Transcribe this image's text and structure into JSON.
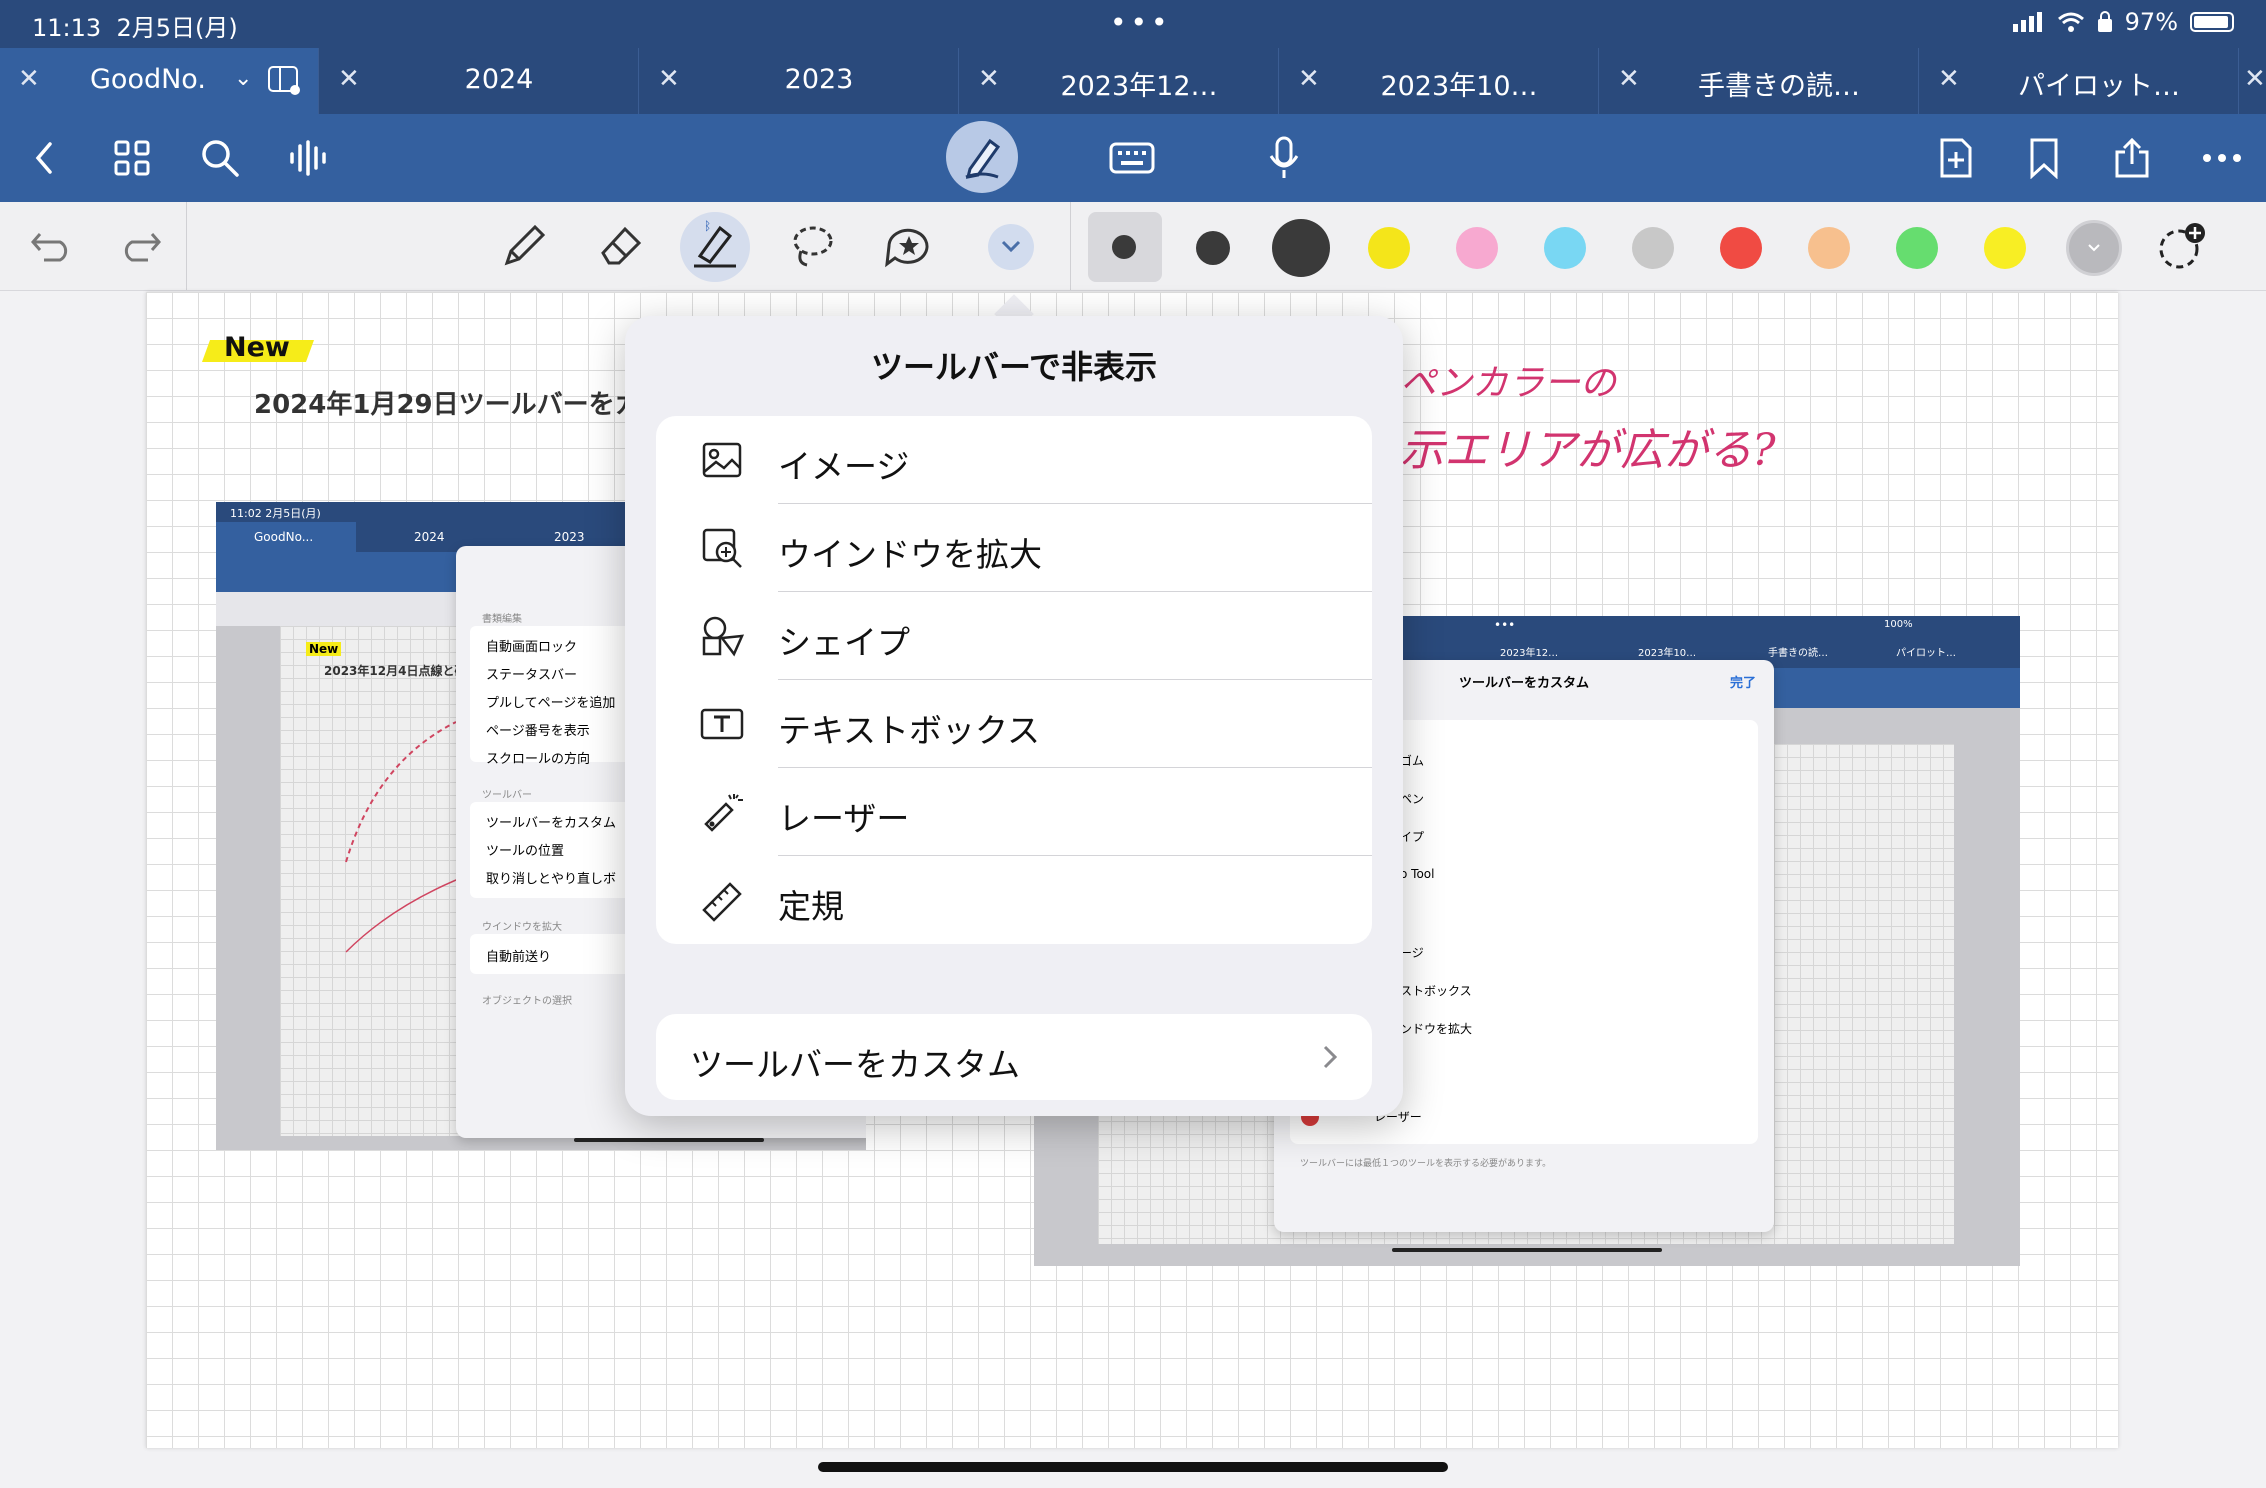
{
  "status": {
    "time": "11:13",
    "date": "2月5日(月)",
    "battery": "97%"
  },
  "tabs": [
    {
      "label": "GoodNo...",
      "active": true
    },
    {
      "label": "2024"
    },
    {
      "label": "2023"
    },
    {
      "label": "2023年12…"
    },
    {
      "label": "2023年10…"
    },
    {
      "label": "手書きの読…"
    },
    {
      "label": "パイロット…"
    }
  ],
  "toolbar_colors": [
    "#3a3a3a",
    "#3a3a3a",
    "#3a3a3a",
    "#f4e51a",
    "#f7a9d0",
    "#79d7f3",
    "#c8c8c8",
    "#f04b43",
    "#f7c08e",
    "#66dd6f",
    "#f8ee24",
    "#b9b9bd"
  ],
  "canvas": {
    "new_badge": "New",
    "heading": "2024年1月29日ツールバーをカ",
    "handwriting_line1": "ペンカラーの",
    "handwriting_line2": "示エリアが広がる?",
    "left_shot": {
      "time": "11:02  2月5日(月)",
      "tabs": [
        "GoodNo...",
        "2024",
        "2023"
      ],
      "new": "New",
      "heading": "2023年12月4日点線と破",
      "menu_section1": "書類編集",
      "menu_items1": [
        "自動画面ロック",
        "ステータスバー",
        "プルしてページを追加",
        "ページ番号を表示",
        "スクロールの方向"
      ],
      "menu_section2": "ツールバー",
      "menu_items2": [
        "ツールバーをカスタム",
        "ツールの位置",
        "取り消しとやり直しボ"
      ],
      "menu_section3": "ウインドウを拡大",
      "menu_items3": [
        "自動前送り"
      ],
      "menu_section4": "オブジェクトの選択"
    },
    "right_shot": {
      "tabs": [
        "2023年12…",
        "2023年10…",
        "手書きの読…",
        "パイロット…"
      ],
      "status": "100%",
      "sheet_title": "ツールバーをカスタム",
      "done": "完了",
      "items": [
        "",
        "ゴム",
        "ペン",
        "イプ",
        "o Tool",
        "",
        "ージ",
        "ストボックス",
        "ンドウを拡大",
        "",
        "レーザー"
      ],
      "footer": "ツールバーには最低１つのツールを表示する必要があります。"
    }
  },
  "popover": {
    "title": "ツールバーで非表示",
    "items": [
      {
        "icon": "image-icon",
        "label": "イメージ"
      },
      {
        "icon": "zoom-window-icon",
        "label": "ウインドウを拡大"
      },
      {
        "icon": "shapes-icon",
        "label": "シェイプ"
      },
      {
        "icon": "textbox-icon",
        "label": "テキストボックス"
      },
      {
        "icon": "laser-pointer-icon",
        "label": "レーザー"
      },
      {
        "icon": "ruler-icon",
        "label": "定規"
      }
    ],
    "customize_label": "ツールバーをカスタム"
  }
}
